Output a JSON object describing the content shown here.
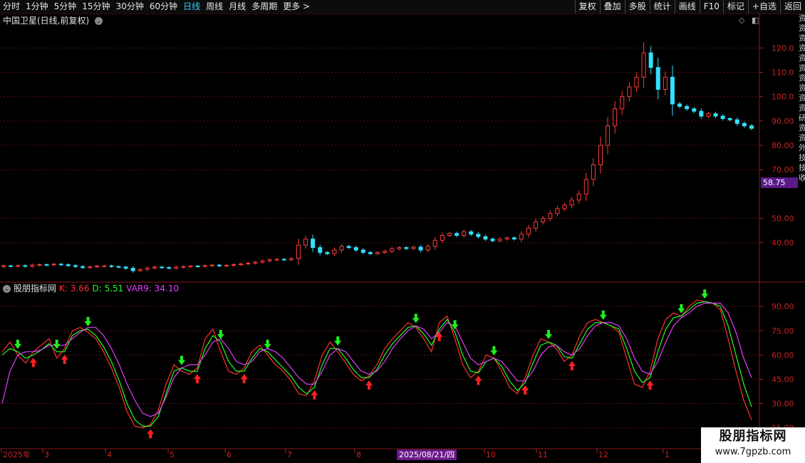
{
  "toolbar": {
    "periods": [
      "分时",
      "1分钟",
      "5分钟",
      "15分钟",
      "30分钟",
      "60分钟",
      "日线",
      "周线",
      "月线",
      "多周期",
      "更多 >"
    ],
    "active_period": "日线",
    "actions": [
      "复权",
      "叠加",
      "多股",
      "统计",
      "画线",
      "F10",
      "标记",
      "+自选",
      "返回"
    ]
  },
  "stock": {
    "title": "中国卫星(日线,前复权)",
    "current_price_tag": "58.75"
  },
  "price_axis": {
    "labels": [
      "120.0",
      "110.0",
      "100.0",
      "90.00",
      "80.00",
      "70.00",
      "50.00",
      "40.00"
    ],
    "values": [
      120,
      110,
      100,
      90,
      80,
      70,
      50,
      40
    ]
  },
  "indicator": {
    "name": "股朋指标网",
    "k_label": "K: 3.66",
    "d_label": "D: 5.51",
    "var9_label": "VAR9: 34.10",
    "axis_labels": [
      "90.00",
      "75.00",
      "60.00",
      "45.00",
      "30.00",
      "15.00"
    ],
    "axis_values": [
      90,
      75,
      60,
      45,
      30,
      15
    ]
  },
  "dates": {
    "labels": [
      "2025年",
      "3",
      "4",
      "5",
      "6",
      "7",
      "8",
      "10",
      "11",
      "12",
      "1"
    ],
    "cursor": "2025/08/21/四"
  },
  "watermark": {
    "title": "股朋指标网",
    "url": "www.7gpzb.com"
  },
  "side_strip": "资资资资资资资资资资研资资外技技收",
  "colors": {
    "up": "#ff3b3b",
    "down": "#33e0ff",
    "k_line": "#ff3030",
    "d_line": "#20ff20",
    "var9_line": "#e040fb",
    "grid": "#5a1212",
    "axis_text": "#cc2222"
  },
  "chart_data": [
    {
      "type": "candlestick",
      "title": "中国卫星(日线,前复权)",
      "ylim": [
        25,
        128
      ],
      "x_range": [
        "2025-01",
        "2026-01"
      ],
      "closes": [
        30.5,
        30.4,
        30.6,
        30.3,
        30.8,
        31.0,
        30.9,
        31.2,
        31.0,
        30.6,
        30.2,
        29.8,
        30.1,
        30.4,
        30.5,
        30.2,
        30.0,
        29.5,
        28.5,
        29.0,
        29.6,
        30.0,
        29.8,
        29.5,
        30.0,
        30.2,
        30.4,
        30.3,
        30.6,
        30.8,
        30.5,
        30.7,
        31.0,
        31.3,
        31.6,
        32.0,
        32.5,
        33.0,
        33.2,
        33.0,
        33.5,
        39.0,
        41.5,
        38.0,
        36.0,
        35.5,
        37.0,
        38.5,
        38.0,
        37.0,
        36.0,
        35.5,
        36.0,
        36.5,
        37.5,
        38.0,
        37.6,
        38.2,
        37.0,
        38.5,
        41.0,
        43.0,
        43.8,
        43.0,
        44.5,
        43.5,
        42.5,
        41.5,
        40.8,
        41.5,
        42.0,
        41.5,
        43.5,
        46.0,
        48.5,
        50.0,
        52.0,
        54.0,
        55.5,
        57.5,
        60.0,
        66.0,
        72.0,
        80.0,
        88.0,
        95.0,
        100.0,
        104.0,
        108.0,
        118.0,
        112.0,
        103.0,
        108.0,
        97.0,
        96.0,
        95.0,
        94.0,
        92.0,
        93.0,
        92.0,
        91.0,
        90.5,
        89.0,
        88.0,
        87.0
      ],
      "last_price": 58.75
    },
    {
      "type": "line",
      "title": "股朋指标网",
      "ylim": [
        10,
        98
      ],
      "series": [
        {
          "name": "K",
          "values": [
            62,
            68,
            60,
            55,
            62,
            66,
            70,
            58,
            64,
            75,
            77,
            74,
            70,
            62,
            52,
            40,
            25,
            16,
            15,
            17,
            26,
            42,
            54,
            50,
            48,
            52,
            70,
            76,
            62,
            50,
            48,
            52,
            62,
            66,
            60,
            54,
            50,
            44,
            36,
            35,
            44,
            60,
            68,
            62,
            55,
            48,
            44,
            47,
            54,
            64,
            70,
            75,
            80,
            77,
            70,
            62,
            80,
            84,
            70,
            54,
            46,
            50,
            60,
            58,
            50,
            40,
            36,
            46,
            60,
            70,
            68,
            64,
            56,
            60,
            72,
            80,
            82,
            80,
            78,
            74,
            58,
            42,
            40,
            50,
            70,
            82,
            86,
            84,
            90,
            94,
            93,
            92,
            88,
            70,
            50,
            32,
            20
          ]
        },
        {
          "name": "D",
          "values": [
            60,
            64,
            62,
            58,
            60,
            63,
            67,
            62,
            62,
            72,
            75,
            76,
            72,
            65,
            56,
            44,
            30,
            20,
            16,
            16,
            22,
            36,
            50,
            52,
            50,
            50,
            64,
            72,
            68,
            56,
            50,
            50,
            58,
            64,
            62,
            57,
            52,
            47,
            40,
            36,
            40,
            54,
            64,
            64,
            58,
            51,
            46,
            46,
            51,
            60,
            67,
            72,
            77,
            78,
            73,
            66,
            76,
            82,
            74,
            60,
            50,
            49,
            56,
            58,
            53,
            44,
            38,
            43,
            55,
            66,
            68,
            66,
            59,
            58,
            67,
            76,
            80,
            80,
            78,
            76,
            64,
            50,
            43,
            46,
            62,
            76,
            83,
            84,
            88,
            92,
            93,
            92,
            90,
            78,
            60,
            42,
            28
          ]
        },
        {
          "name": "VAR9",
          "values": [
            30,
            50,
            60,
            62,
            62,
            63,
            66,
            66,
            66,
            70,
            74,
            77,
            77,
            72,
            64,
            54,
            42,
            32,
            24,
            22,
            24,
            34,
            46,
            52,
            54,
            54,
            60,
            68,
            70,
            64,
            56,
            54,
            56,
            62,
            64,
            62,
            58,
            52,
            46,
            42,
            42,
            50,
            60,
            64,
            62,
            56,
            50,
            48,
            50,
            56,
            64,
            70,
            75,
            78,
            76,
            70,
            74,
            80,
            78,
            68,
            58,
            54,
            56,
            58,
            56,
            50,
            44,
            44,
            50,
            60,
            65,
            66,
            62,
            60,
            64,
            72,
            78,
            80,
            80,
            78,
            70,
            58,
            50,
            48,
            56,
            68,
            78,
            83,
            86,
            90,
            92,
            92,
            92,
            86,
            74,
            58,
            46
          ]
        }
      ]
    }
  ]
}
